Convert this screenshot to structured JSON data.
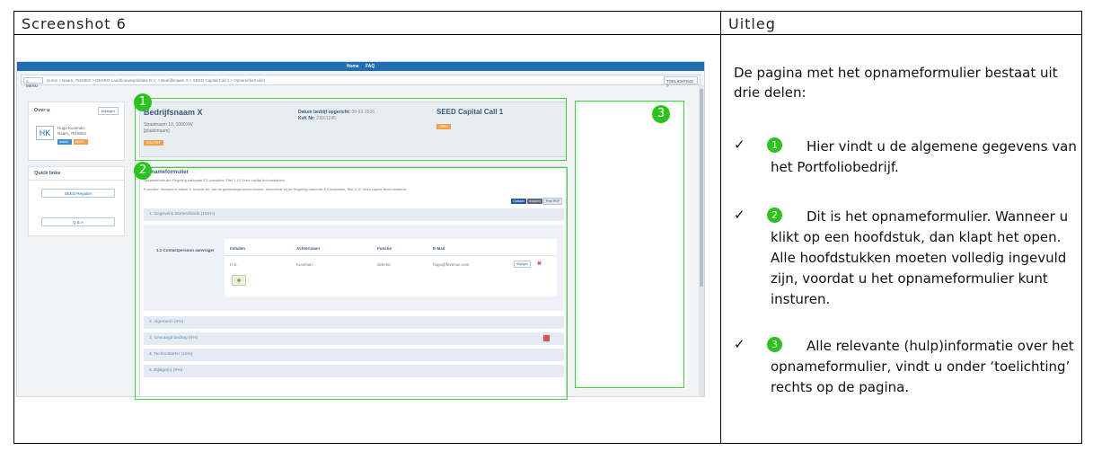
{
  "header": {
    "left_title": "Screenshot 6",
    "right_title": "Uitleg"
  },
  "screenshot": {
    "nav": [
      "Home",
      "FAQ"
    ],
    "crumb_menu": "< MENU",
    "breadcrumb": "Home  >  Naam_7918802  >  DEKRO-Landbouwexploitatie B.V.  >  Bedrijfsnaam X  >  SEED Capital Call 1  >  Opnameformulier",
    "toelichting_button": "TOELICHTING >",
    "over_u": {
      "title": "Over u",
      "edit": "Wijzigen",
      "initials": "HK",
      "name": "Hugo Kooiman",
      "user": "Naam_7918802",
      "badge1": "Admin",
      "badge2": "Actief"
    },
    "quick_links": {
      "title": "Quick links",
      "btn1": "SEED Regulier",
      "btn2": "Q & A"
    },
    "bedrijf": {
      "name": "Bedrijfsnaam X",
      "address": "Straatnaam 10, 1000XW",
      "city": "[plaatsnaam]",
      "status": "INACTIEF",
      "datum_label": "Datum bedrijf opgericht:",
      "datum_value": "09-02-2016",
      "kvk_label": "KvK Nr:",
      "kvk_value": "21161245",
      "call": "SEED Capital Call 1",
      "call_status": "OPEN"
    },
    "form": {
      "title": "Opnameformulier",
      "subtitle": "Opnameformulier Regeling nationale EZ-subsidies, Titel 3.10 Seed capital technostarters",
      "description": "Formulier, bedoeld in artikel 3, tweede lid, van de geldleningsovereenkomst, behorende bij de Regeling nationale EZ-subsidies, Titel 3.10 Seed capital technostarters.",
      "btn_opslaan": "Opslaan",
      "btn_insturen": "Insturen",
      "btn_pdf": "Print PDF",
      "sections": [
        "1. Gegevens startersfonds (100%)",
        "2. Algemeen (0%)",
        "3. Gevraagd bedrag (0%)",
        "4. Technostarter (15%)",
        "5. Bijlage(n) (0%)"
      ],
      "contact": {
        "title": "1.1 Contactpersoon aanvrager",
        "headers": [
          "Initialen",
          "Achternaam",
          "Functie",
          "E-Mail"
        ],
        "row": [
          "H.E.",
          "Kooiman",
          "director",
          "hugo@fevenue.com"
        ],
        "edit": "Wijzigen",
        "delete": "✖",
        "add": "+"
      }
    },
    "markers": [
      "1",
      "2",
      "3"
    ]
  },
  "explanation": {
    "intro": "De pagina met het opnameformulier bestaat uit drie delen:",
    "items": [
      {
        "num": "1",
        "text": "Hier vindt u de algemene gegevens van het Portfoliobedrijf."
      },
      {
        "num": "2",
        "text": "Dit is het opnameformulier. Wanneer u klikt op een hoofdstuk, dan klapt het open. Alle hoofdstukken moeten volledig ingevuld zijn, voordat u het opnameformulier kunt insturen."
      },
      {
        "num": "3",
        "text": "Alle relevante (hulp)informatie over het opnameformulier, vindt u onder ‘toelichting’ rechts op de pagina."
      }
    ],
    "check": "✓"
  },
  "colors": {
    "green_marker": "#2bc41e",
    "highlight_border": "#3ad43a",
    "nav_blue": "#1f6fb2"
  }
}
